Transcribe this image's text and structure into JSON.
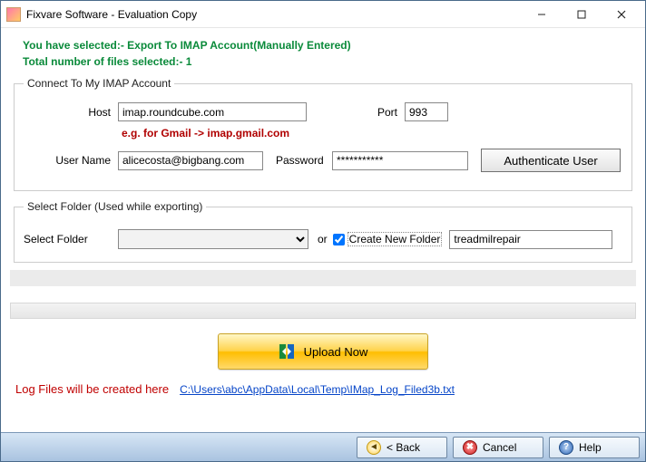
{
  "window": {
    "title": "Fixvare Software - Evaluation Copy"
  },
  "header": {
    "selected_line": "You have selected:- Export To IMAP Account(Manually Entered)",
    "file_count_line": "Total number of files selected:- 1"
  },
  "imap_group": {
    "legend": "Connect To My IMAP Account",
    "host_label": "Host",
    "host_value": "imap.roundcube.com",
    "port_label": "Port",
    "port_value": "993",
    "hint": "e.g. for Gmail -> imap.gmail.com",
    "username_label": "User Name",
    "username_value": "alicecosta@bigbang.com",
    "password_label": "Password",
    "password_value": "***********",
    "auth_button": "Authenticate User"
  },
  "folder_group": {
    "legend": "Select Folder (Used while exporting)",
    "select_label": "Select Folder",
    "select_value": "",
    "or_text": "or",
    "create_checked": true,
    "create_label": "Create New Folder",
    "new_folder_value": "treadmilrepair"
  },
  "upload_button": "Upload Now",
  "log": {
    "label": "Log Files will be created here",
    "path": "C:\\Users\\abc\\AppData\\Local\\Temp\\IMap_Log_Filed3b.txt"
  },
  "footer": {
    "back": "< Back",
    "cancel": "Cancel",
    "help": "Help"
  }
}
